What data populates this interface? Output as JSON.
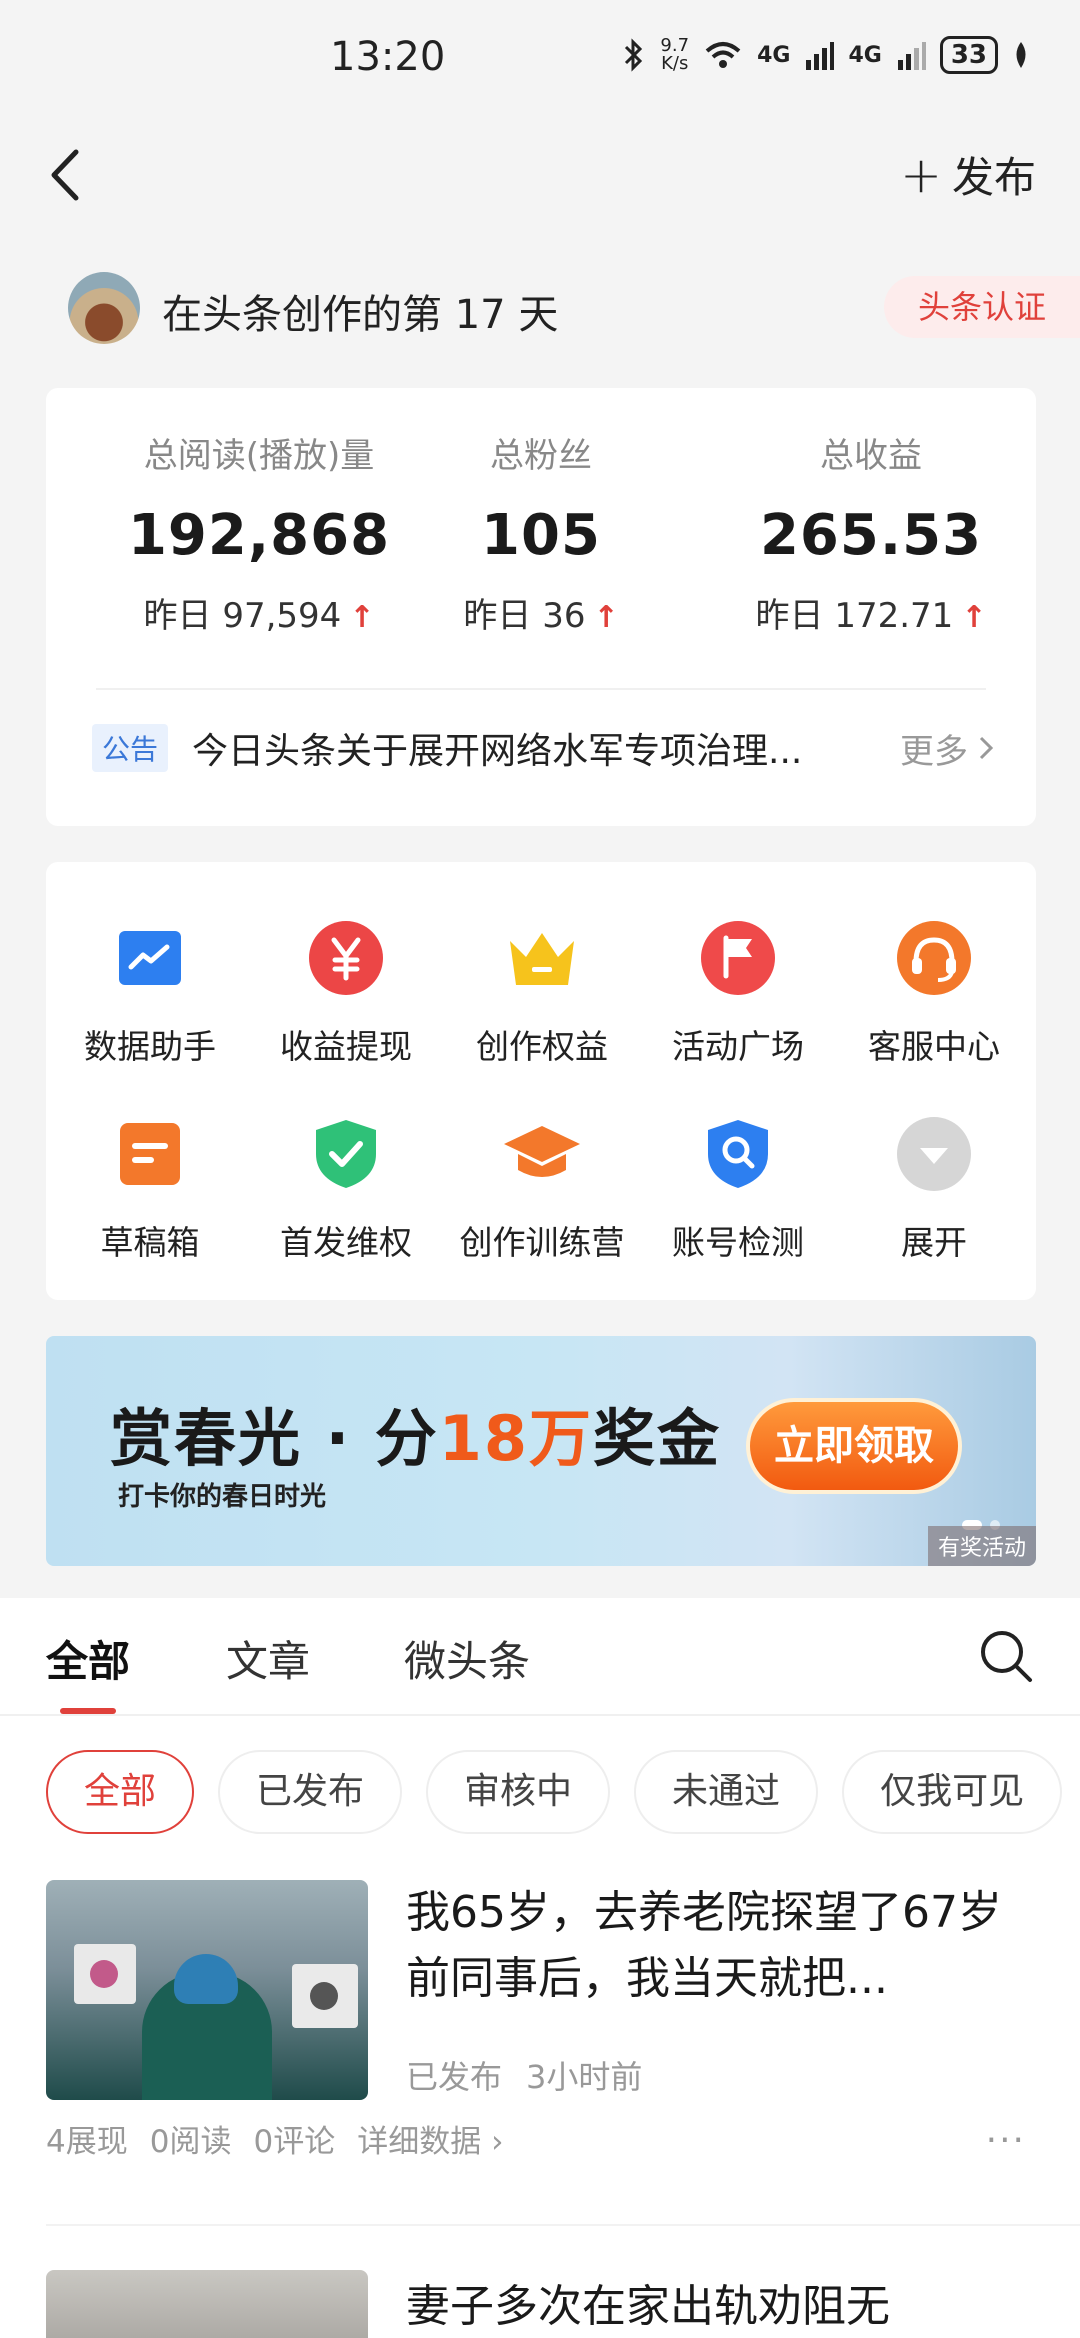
{
  "status_bar": {
    "time": "13:20",
    "speed_top": "9.7",
    "speed_bottom": "K/s",
    "net1": "4G",
    "net2": "4G",
    "battery": "33"
  },
  "header": {
    "publish_label": "发布"
  },
  "profile": {
    "days_text": "在头条创作的第 17 天",
    "verify_label": "头条认证"
  },
  "stats": [
    {
      "label": "总阅读(播放)量",
      "value": "192,868",
      "yesterday": "昨日 97,594"
    },
    {
      "label": "总粉丝",
      "value": "105",
      "yesterday": "昨日 36"
    },
    {
      "label": "总收益",
      "value": "265.53",
      "yesterday": "昨日 172.71"
    }
  ],
  "notice": {
    "tag": "公告",
    "text": "今日头条关于展开网络水军专项治理...",
    "more": "更多"
  },
  "tools": [
    {
      "label": "数据助手",
      "icon": "chart-icon"
    },
    {
      "label": "收益提现",
      "icon": "yuan-icon"
    },
    {
      "label": "创作权益",
      "icon": "crown-icon"
    },
    {
      "label": "活动广场",
      "icon": "flag-icon"
    },
    {
      "label": "客服中心",
      "icon": "headset-icon"
    },
    {
      "label": "草稿箱",
      "icon": "draft-icon"
    },
    {
      "label": "首发维权",
      "icon": "shield-check-icon"
    },
    {
      "label": "创作训练营",
      "icon": "graduation-cap-icon"
    },
    {
      "label": "账号检测",
      "icon": "shield-search-icon"
    },
    {
      "label": "展开",
      "icon": "expand-icon"
    }
  ],
  "banner": {
    "title_pre": "赏春光 · 分",
    "title_highlight": "18万",
    "title_post": "奖金",
    "subtitle": "打卡你的春日时光",
    "button": "立即领取",
    "tag": "有奖活动"
  },
  "tabs": [
    "全部",
    "文章",
    "微头条"
  ],
  "filters": [
    "全部",
    "已发布",
    "审核中",
    "未通过",
    "仅我可见"
  ],
  "article": {
    "title": "我65岁，去养老院探望了67岁前同事后，我当天就把...",
    "status": "已发布",
    "time": "3小时前",
    "impressions": "4展现",
    "reads": "0阅读",
    "comments": "0评论",
    "details": "详细数据"
  },
  "article2": {
    "title": "妻子多次在家出轨劝阻无"
  },
  "colors": {
    "accent": "#e0413b",
    "notice_tag": "#3b78d8"
  }
}
